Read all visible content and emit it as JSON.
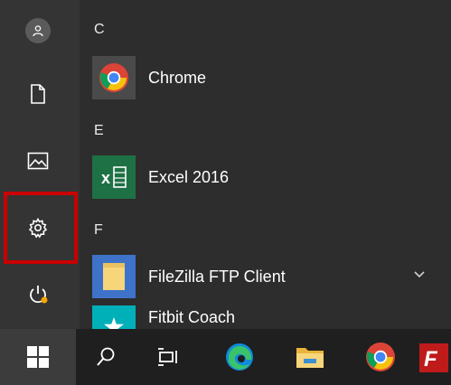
{
  "start_menu": {
    "sections": [
      {
        "letter": "C",
        "apps": [
          {
            "label": "Chrome",
            "icon": "chrome-icon"
          }
        ]
      },
      {
        "letter": "E",
        "apps": [
          {
            "label": "Excel 2016",
            "icon": "excel-icon"
          }
        ]
      },
      {
        "letter": "F",
        "apps": [
          {
            "label": "FileZilla FTP Client",
            "icon": "folder-icon"
          },
          {
            "label": "Fitbit Coach",
            "icon": "fitbit-icon"
          }
        ]
      }
    ]
  },
  "rail": {
    "items": [
      "user-icon",
      "documents-icon",
      "pictures-icon",
      "settings-icon",
      "power-icon"
    ]
  },
  "taskbar": {
    "items": [
      "windows-start-icon",
      "search-icon",
      "task-view-icon",
      "edge-icon",
      "file-explorer-icon",
      "chrome-icon",
      "filezilla-icon"
    ],
    "filezilla_glyph": "F"
  },
  "colors": {
    "highlight": "#c90000",
    "excel_green": "#1e7145",
    "chrome_red": "#db4437",
    "chrome_yellow": "#f4c20d",
    "chrome_green": "#0f9d58",
    "chrome_blue": "#4285f4",
    "fitbit_tile": "#00b0b9",
    "folder_yellow": "#f7d57b",
    "edge_blue": "#0f8cd8",
    "edge_green": "#3ac36a"
  }
}
